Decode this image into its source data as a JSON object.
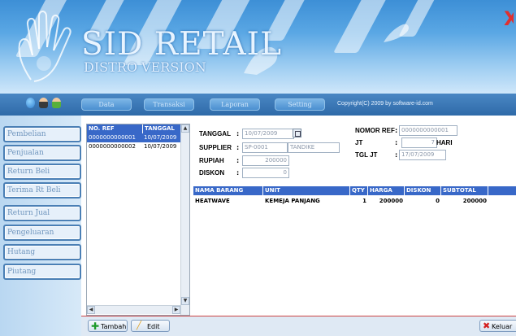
{
  "header": {
    "title": "SID RETAIL",
    "subtitle": "DISTRO VERSION",
    "close_glyph": "X"
  },
  "menubar": {
    "icons": [
      "globe-icon",
      "user-icon",
      "user-green-icon"
    ],
    "items": [
      {
        "label": "Data"
      },
      {
        "label": "Transaksi"
      },
      {
        "label": "Laporan"
      },
      {
        "label": "Setting"
      }
    ],
    "copyright": "Copyright(C) 2009 by software-id.com"
  },
  "sidebar": {
    "items": [
      {
        "label": "Pembelian"
      },
      {
        "label": "Penjualan"
      },
      {
        "label": "Return Beli"
      },
      {
        "label": "Terima Rt Beli"
      },
      {
        "label": "Return Jual"
      },
      {
        "label": "Pengeluaran"
      },
      {
        "label": "Hutang"
      },
      {
        "label": "Piutang"
      }
    ]
  },
  "list": {
    "columns": [
      "NO. REF",
      "TANGGAL"
    ],
    "rows": [
      {
        "ref": "0000000000001",
        "date": "10/07/2009",
        "selected": true
      },
      {
        "ref": "0000000000002",
        "date": "10/07/2009",
        "selected": false
      }
    ]
  },
  "form": {
    "tanggal_label": "TANGGAL",
    "tanggal_value": "10/07/2009",
    "supplier_label": "SUPPLIER",
    "supplier_code": "SP-0001",
    "supplier_name": "TANDIKE",
    "rupiah_label": "RUPIAH",
    "rupiah_value": "200000",
    "diskon_label": "DISKON",
    "diskon_value": "0",
    "nomor_ref_label": "NOMOR REF",
    "nomor_ref_value": "0000000000001",
    "jt_label": "JT",
    "jt_value": "7",
    "jt_unit": "HARI",
    "tgl_jt_label": "TGL JT",
    "tgl_jt_value": "17/07/2009",
    "colon": ":"
  },
  "grid": {
    "columns": [
      "NAMA BARANG",
      "UNIT",
      "QTY",
      "HARGA",
      "DISKON",
      "SUBTOTAL"
    ],
    "rows": [
      {
        "nama": "HEATWAVE",
        "unit": "KEMEJA PANJANG",
        "qty": "1",
        "harga": "200000",
        "diskon": "0",
        "subtotal": "200000"
      }
    ]
  },
  "actions": {
    "add_label": "Tambah",
    "edit_label": "Edit",
    "exit_label": "Keluar"
  },
  "colors": {
    "accent": "#3868c8",
    "header_blue": "#3d8fd6",
    "selection": "#3868c8"
  }
}
